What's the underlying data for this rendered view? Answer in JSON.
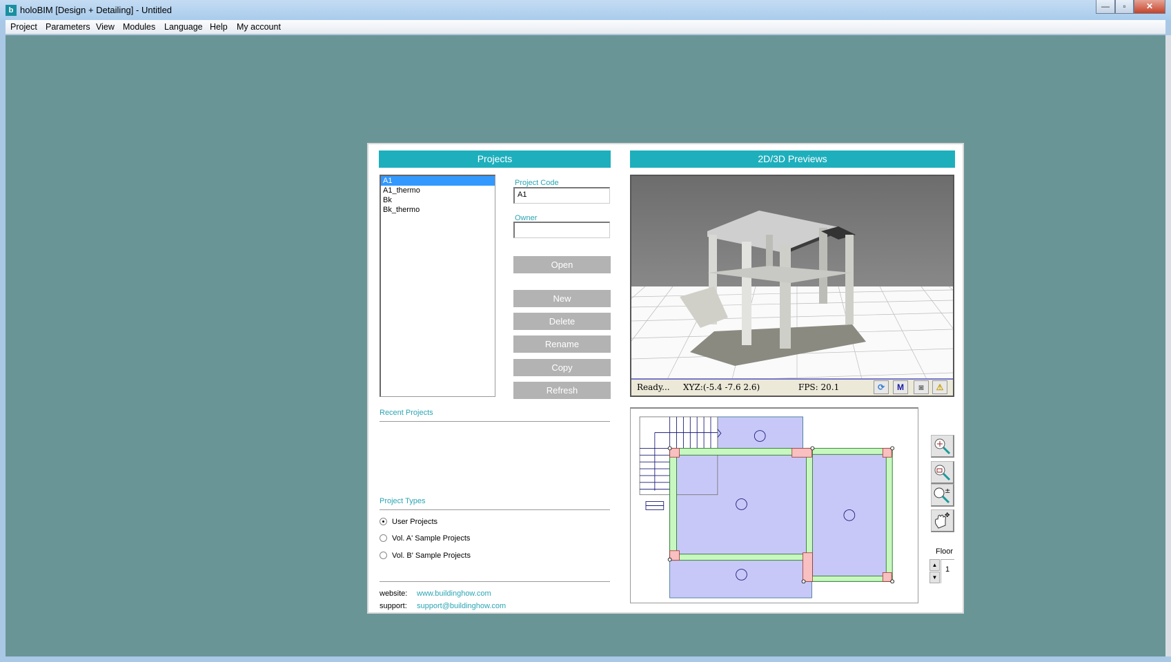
{
  "window": {
    "title": "holoBIM [Design + Detailing] - Untitled",
    "app_icon": "holobim-logo",
    "minimize": "—",
    "maximize": "▫",
    "close": "✕"
  },
  "menu": [
    "Project",
    "Parameters",
    "View",
    "Modules",
    "Language",
    "Help",
    "My account"
  ],
  "projects": {
    "header": "Projects",
    "list": [
      "A1",
      "A1_thermo",
      "Bk",
      "Bk_thermo"
    ],
    "selected": "A1",
    "code_label": "Project Code",
    "code_value": "A1",
    "owner_label": "Owner",
    "owner_value": "",
    "buttons": {
      "open": "Open",
      "new": "New",
      "delete": "Delete",
      "rename": "Rename",
      "copy": "Copy",
      "refresh": "Refresh"
    }
  },
  "recent": {
    "label": "Recent Projects"
  },
  "types": {
    "label": "Project Types",
    "options": [
      "User Projects",
      "Vol. A' Sample Projects",
      "Vol. B' Sample Projects"
    ],
    "selected": "User Projects"
  },
  "footer": {
    "website_label": "website:",
    "website": "www.buildinghow.com",
    "support_label": "support:",
    "support": "support@buildinghow.com"
  },
  "previews": {
    "header": "2D/3D Previews",
    "status": {
      "ready": "Ready...",
      "xyz": "XYZ:(-5.4 -7.6  2.6)",
      "fps": "FPS: 20.1",
      "m_label": "M"
    },
    "floor_label": "Floor",
    "floor_value": "1"
  },
  "colors": {
    "accent": "#1eafbd",
    "background": "#6a9597",
    "button": "#b3b3b3",
    "selection": "#3399ff"
  }
}
